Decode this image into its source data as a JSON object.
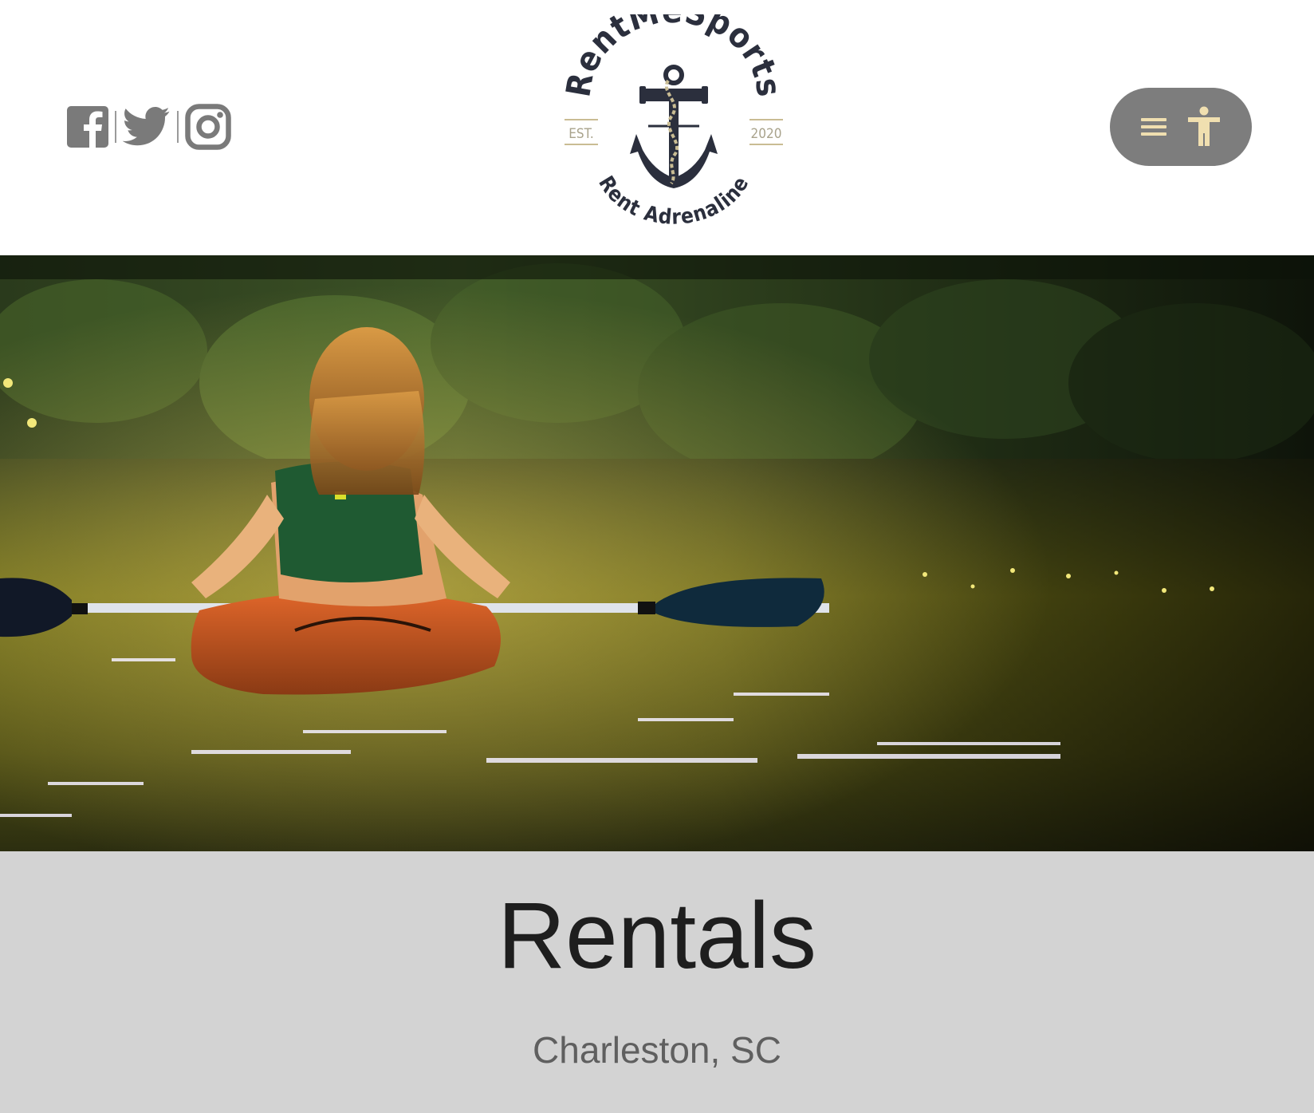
{
  "header": {
    "social": [
      {
        "name": "facebook-icon"
      },
      {
        "name": "twitter-icon"
      },
      {
        "name": "instagram-icon"
      }
    ],
    "logo": {
      "brand": "RentMeSports",
      "est": "EST.",
      "year": "2020",
      "tagline": "Rent Adrenaline"
    },
    "menu": {
      "icons": [
        "hamburger-icon",
        "accessibility-icon"
      ],
      "pill_color": "#7d7d7d",
      "icon_color": "#f0dfb0"
    }
  },
  "hero": {
    "image": "woman-kayaking-on-river"
  },
  "page": {
    "title": "Rentals",
    "subtitle": "Charleston, SC"
  },
  "colors": {
    "band": "#d3d3d3",
    "title": "#1e1e1e",
    "subtitle": "#5f5f5f",
    "logo_dark": "#2b2f3d",
    "logo_rope": "#c9bc93"
  }
}
